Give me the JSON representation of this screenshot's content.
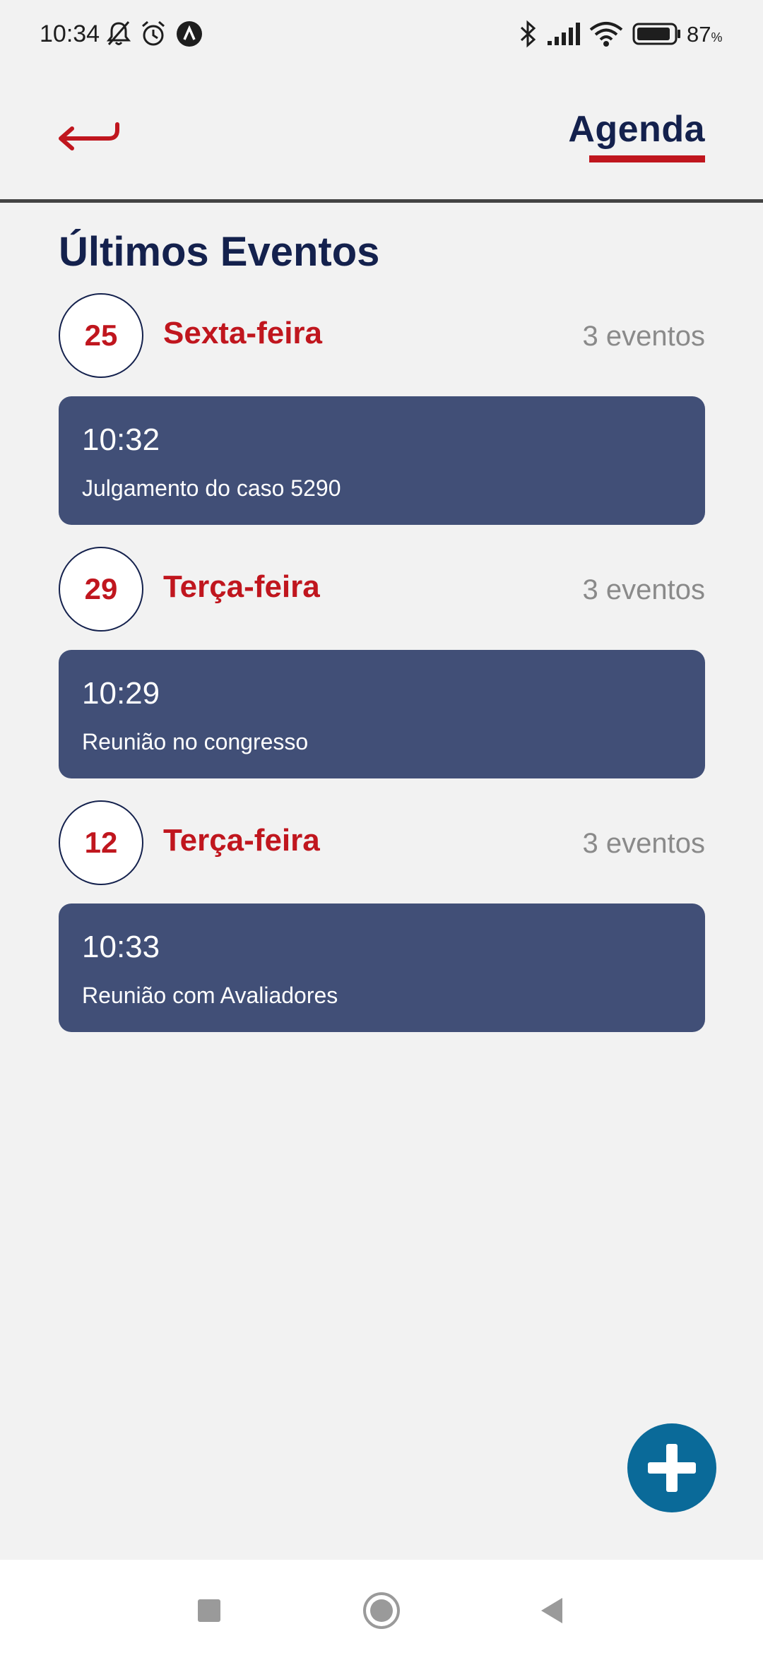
{
  "status_bar": {
    "time": "10:34",
    "battery": "87",
    "battery_unit": "%",
    "icons": [
      "bell-off-icon",
      "alarm-icon",
      "app-notification-icon",
      "bluetooth-icon",
      "signal-icon",
      "wifi-icon",
      "battery-icon"
    ]
  },
  "header": {
    "title": "Agenda",
    "back_icon": "return-arrow-icon"
  },
  "section_title": "Últimos Eventos",
  "days": [
    {
      "day": "25",
      "weekday": "Sexta-feira",
      "count": "3 eventos",
      "event": {
        "time": "10:32",
        "description": "Julgamento do caso 5290"
      }
    },
    {
      "day": "29",
      "weekday": "Terça-feira",
      "count": "3 eventos",
      "event": {
        "time": "10:29",
        "description": "Reunião no congresso"
      }
    },
    {
      "day": "12",
      "weekday": "Terça-feira",
      "count": "3 eventos",
      "event": {
        "time": "10:33",
        "description": "Reunião com Avaliadores"
      }
    }
  ],
  "fab_icon": "plus-icon",
  "nav_icons": [
    "recents-square-icon",
    "home-circle-icon",
    "back-triangle-icon"
  ],
  "colors": {
    "primary_navy": "#14214d",
    "accent_red": "#c0161e",
    "card_bg": "#414f77",
    "fab_blue": "#0a6a99",
    "background": "#f2f2f2"
  }
}
